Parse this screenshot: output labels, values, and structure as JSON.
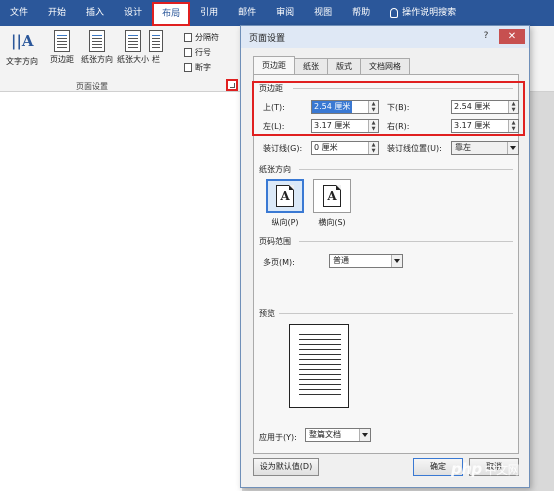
{
  "ribbon": {
    "tabs": [
      {
        "label": "文件"
      },
      {
        "label": "开始"
      },
      {
        "label": "插入"
      },
      {
        "label": "设计"
      },
      {
        "label": "布局",
        "active": true
      },
      {
        "label": "引用"
      },
      {
        "label": "邮件"
      },
      {
        "label": "审阅"
      },
      {
        "label": "视图"
      },
      {
        "label": "帮助"
      }
    ],
    "tell_me": "操作说明搜索",
    "buttons": {
      "text_direction": "文字方向",
      "margins": "页边距",
      "orientation": "纸张方向",
      "size": "纸张大小",
      "columns": "栏",
      "breaks": "分隔符",
      "line_numbers": "行号",
      "hyphenation": "断字"
    },
    "group_label": "页面设置"
  },
  "dialog": {
    "title": "页面设置",
    "help": "?",
    "close": "✕",
    "tabs": [
      "页边距",
      "纸张",
      "版式",
      "文档网格"
    ],
    "margins_section": "页边距",
    "top_label": "上(T):",
    "top_value": "2.54 厘米",
    "bottom_label": "下(B):",
    "bottom_value": "2.54 厘米",
    "left_label": "左(L):",
    "left_value": "3.17 厘米",
    "right_label": "右(R):",
    "right_value": "3.17 厘米",
    "gutter_label": "装订线(G):",
    "gutter_value": "0 厘米",
    "gutter_pos_label": "装订线位置(U):",
    "gutter_pos_value": "靠左",
    "orientation_section": "纸张方向",
    "portrait_label": "纵向(P)",
    "landscape_label": "横向(S)",
    "orient_glyph": "A",
    "pages_section": "页码范围",
    "multiple_pages_label": "多页(M):",
    "multiple_pages_value": "普通",
    "preview_section": "预览",
    "apply_to_label": "应用于(Y):",
    "apply_to_value": "整篇文档",
    "set_default": "设为默认值(D)",
    "ok": "确定",
    "cancel": "取消"
  },
  "watermark": {
    "brand": "php",
    "suffix": "中文网"
  }
}
